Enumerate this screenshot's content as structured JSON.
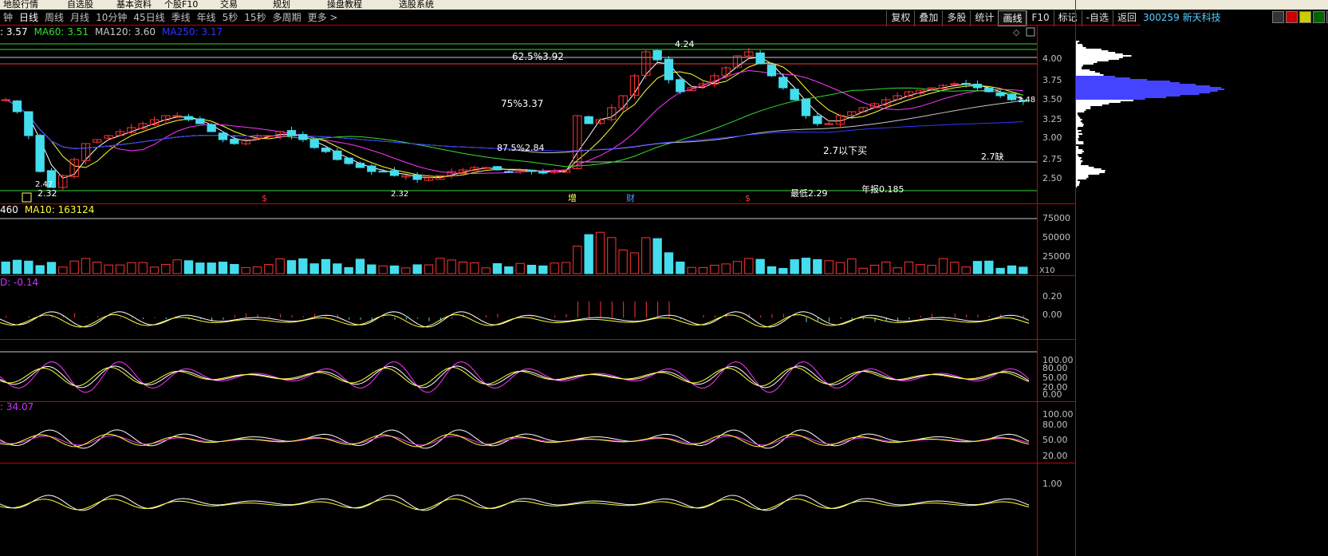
{
  "top_menu": [
    "地股行情",
    "自选股",
    "基本资料",
    "个股F10",
    "交易",
    "规划",
    "操盘教程",
    "选股系统"
  ],
  "periods": [
    {
      "label": "钟",
      "active": false
    },
    {
      "label": "日线",
      "active": true
    },
    {
      "label": "周线",
      "active": false
    },
    {
      "label": "月线",
      "active": false
    },
    {
      "label": "10分钟",
      "active": false
    },
    {
      "label": "45日线",
      "active": false
    },
    {
      "label": "季线",
      "active": false
    },
    {
      "label": "年线",
      "active": false
    },
    {
      "label": "5秒",
      "active": false
    },
    {
      "label": "15秒",
      "active": false
    },
    {
      "label": "多周期",
      "active": false
    },
    {
      "label": "更多",
      "active": false
    }
  ],
  "right_buttons": [
    {
      "label": "复权",
      "active": false
    },
    {
      "label": "叠加",
      "active": false
    },
    {
      "label": "多股",
      "active": false
    },
    {
      "label": "统计",
      "active": false
    },
    {
      "label": "画线",
      "active": true
    },
    {
      "label": "F10",
      "active": false
    },
    {
      "label": "标记",
      "active": false
    },
    {
      "label": "-自选",
      "active": false
    },
    {
      "label": "返回",
      "active": false
    }
  ],
  "stock": {
    "code_name": "300259 新天科技"
  },
  "ma_legend": [
    {
      "text": ": 3.57",
      "color": "#ffffff"
    },
    {
      "text": "MA60: 3.51",
      "color": "#33dd33"
    },
    {
      "text": "MA120: 3.60",
      "color": "#c8c8c8"
    },
    {
      "text": "MA250: 3.17",
      "color": "#3333ff"
    }
  ],
  "vol_legend": [
    {
      "text": "460",
      "color": "#ffffff"
    },
    {
      "text": "MA10: 163124",
      "color": "#ffff33"
    }
  ],
  "macd_legend": [
    {
      "text": "D: -0.14",
      "color": "#cc33ff"
    }
  ],
  "rsi_legend": [
    {
      "text": ": 34.07",
      "color": "#cc33ff"
    }
  ],
  "price_axis": [
    "4.00",
    "3.75",
    "3.50",
    "3.25",
    "3.00",
    "2.75",
    "2.50"
  ],
  "vol_axis": [
    "75000",
    "50000",
    "25000"
  ],
  "vol_unit": "X10",
  "macd_axis": [
    "0.20",
    "0.00"
  ],
  "kdj_axis": [
    "100.00",
    "80.00",
    "50.00",
    "20.00",
    "0.00"
  ],
  "rsi_axis": [
    "100.00",
    "80.00",
    "50.00",
    "20.00"
  ],
  "last_axis": [
    "1.00"
  ],
  "annotations": {
    "fib_625": "62.5%3.92",
    "fib_75": "75%3.37",
    "fib_875": "87.5%2.84",
    "buy_note": "2.7以下买",
    "gap_note": "2.7缺",
    "high": "4.24",
    "low1": "2.47",
    "low2": "2.32",
    "low3": "2.32",
    "lowest": "最低2.29",
    "report": "年报0.185",
    "current": "3.48"
  },
  "event_markers": [
    "$",
    "增",
    "财",
    "$"
  ],
  "colors": {
    "up": "#ff3333",
    "down": "#44ddee",
    "ma5": "#ffffff",
    "ma10": "#ffff33",
    "ma20": "#ff33ff",
    "ma60": "#33dd33",
    "ma120": "#c8c8c8",
    "ma250": "#3333ff",
    "grid": "#cc0000"
  },
  "chart_data": {
    "type": "candlestick",
    "price_ylim": [
      2.3,
      4.25
    ],
    "close_series": [
      3.5,
      3.35,
      3.05,
      2.6,
      2.4,
      2.55,
      2.75,
      2.95,
      3.0,
      3.05,
      3.1,
      3.15,
      3.2,
      3.25,
      3.3,
      3.3,
      3.25,
      3.2,
      3.1,
      3.0,
      2.95,
      3.0,
      3.05,
      3.05,
      3.1,
      3.05,
      3.0,
      2.9,
      2.85,
      2.75,
      2.7,
      2.65,
      2.6,
      2.6,
      2.55,
      2.55,
      2.5,
      2.52,
      2.55,
      2.6,
      2.62,
      2.65,
      2.65,
      2.62,
      2.6,
      2.62,
      2.6,
      2.58,
      2.6,
      2.62,
      3.3,
      3.2,
      3.25,
      3.4,
      3.55,
      3.8,
      4.1,
      4.0,
      3.75,
      3.6,
      3.65,
      3.7,
      3.8,
      3.9,
      4.05,
      4.1,
      3.95,
      3.8,
      3.65,
      3.5,
      3.3,
      3.2,
      3.2,
      3.3,
      3.35,
      3.4,
      3.45,
      3.5,
      3.55,
      3.6,
      3.62,
      3.65,
      3.68,
      3.7,
      3.7,
      3.65,
      3.6,
      3.55,
      3.5,
      3.48
    ]
  }
}
